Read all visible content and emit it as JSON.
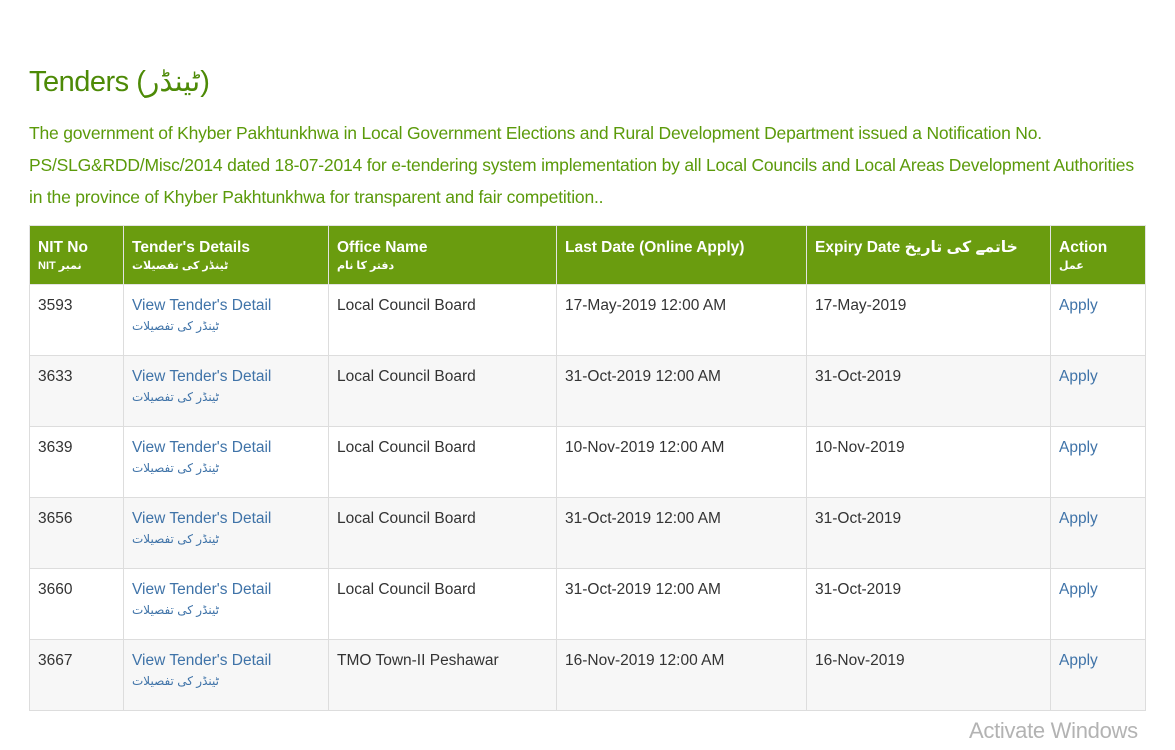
{
  "page": {
    "title": "Tenders (ٹینڈر)",
    "intro": "The government of Khyber Pakhtunkhwa in Local Government Elections and Rural Development Department issued a Notification No. PS/SLG&RDD/Misc/2014 dated 18-07-2014 for e-tendering system implementation by all Local Councils and Local Areas Development Authorities in the province of Khyber Pakhtunkhwa for transparent and fair competition.."
  },
  "table": {
    "headers": [
      {
        "en": "NIT No",
        "ur": "NIT نمبر"
      },
      {
        "en": "Tender's Details",
        "ur": "ٹینڈر کی تفصیلات"
      },
      {
        "en": "Office Name",
        "ur": "دفتر کا نام"
      },
      {
        "en": "Last Date (Online Apply)",
        "ur": ""
      },
      {
        "en": "Expiry Date خاتمے کی تاریخ",
        "ur": ""
      },
      {
        "en": "Action",
        "ur": "عمل"
      }
    ],
    "rows": [
      {
        "nit": "3593",
        "detail": "View Tender's Detail",
        "detail_ur": "ٹینڈر کی تفصیلات",
        "office": "Local Council Board",
        "last_date": "17-May-2019 12:00 AM",
        "expiry": "17-May-2019",
        "action": "Apply"
      },
      {
        "nit": "3633",
        "detail": "View Tender's Detail",
        "detail_ur": "ٹینڈر کی تفصیلات",
        "office": "Local Council Board",
        "last_date": "31-Oct-2019 12:00 AM",
        "expiry": "31-Oct-2019",
        "action": "Apply"
      },
      {
        "nit": "3639",
        "detail": "View Tender's Detail",
        "detail_ur": "ٹینڈر کی تفصیلات",
        "office": "Local Council Board",
        "last_date": "10-Nov-2019 12:00 AM",
        "expiry": "10-Nov-2019",
        "action": "Apply"
      },
      {
        "nit": "3656",
        "detail": "View Tender's Detail",
        "detail_ur": "ٹینڈر کی تفصیلات",
        "office": "Local Council Board",
        "last_date": "31-Oct-2019 12:00 AM",
        "expiry": "31-Oct-2019",
        "action": "Apply"
      },
      {
        "nit": "3660",
        "detail": "View Tender's Detail",
        "detail_ur": "ٹینڈر کی تفصیلات",
        "office": "Local Council Board",
        "last_date": "31-Oct-2019 12:00 AM",
        "expiry": "31-Oct-2019",
        "action": "Apply"
      },
      {
        "nit": "3667",
        "detail": "View Tender's Detail",
        "detail_ur": "ٹینڈر کی تفصیلات",
        "office": "TMO Town-II Peshawar",
        "last_date": "16-Nov-2019 12:00 AM",
        "expiry": "16-Nov-2019",
        "action": "Apply"
      }
    ]
  },
  "watermark": "Activate Windows",
  "colors": {
    "heading_green": "#4d8a06",
    "header_bg": "#6a9c0f",
    "link_blue": "#3f73a8"
  }
}
